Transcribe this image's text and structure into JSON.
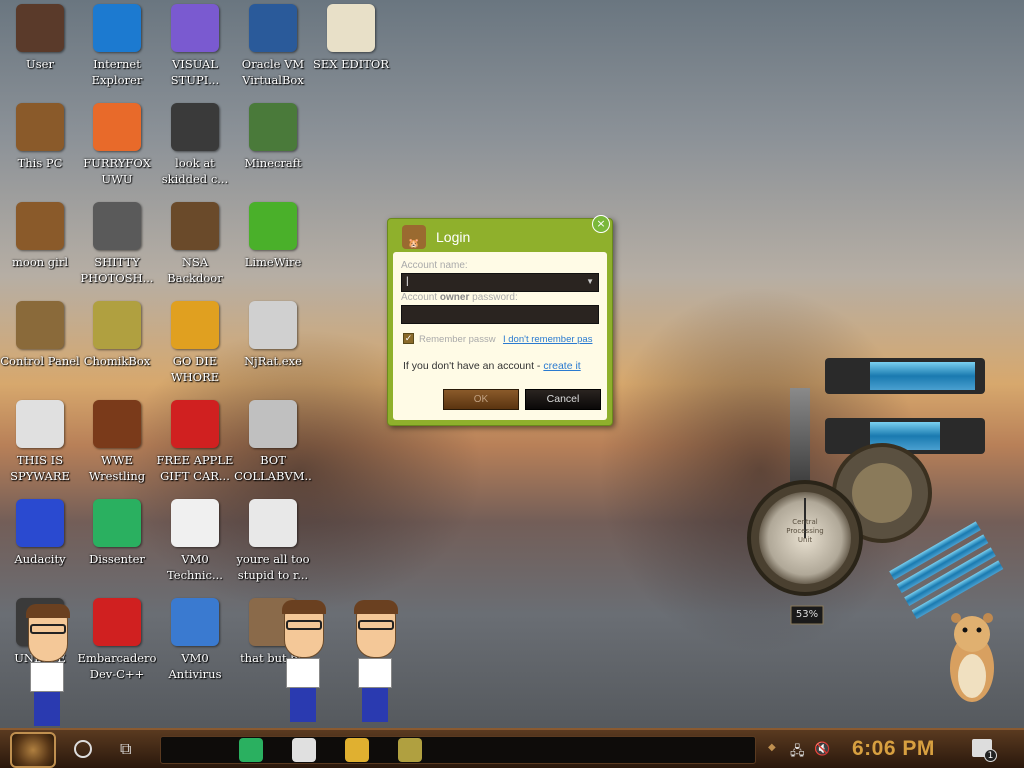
{
  "desktop": {
    "icons": [
      {
        "label": "User",
        "icon": "user-folder-icon",
        "color": "#5a3a2a"
      },
      {
        "label": "Internet Explorer",
        "icon": "edge-browser-icon",
        "color": "#1c7ad0"
      },
      {
        "label": "VISUAL STUPI...",
        "icon": "visual-studio-icon",
        "color": "#7a5ad0"
      },
      {
        "label": "Oracle VM VirtualBox",
        "icon": "virtualbox-icon",
        "color": "#2a5a9a"
      },
      {
        "label": "SEX EDITOR",
        "icon": "hxd-editor-icon",
        "color": "#e8e0c8"
      },
      {
        "label": "This PC",
        "icon": "computer-icon",
        "color": "#8a5a2a"
      },
      {
        "label": "FURRYFOX UWU",
        "icon": "firefox-icon",
        "color": "#e86a2a"
      },
      {
        "label": "look at skidded c...",
        "icon": "files-icon",
        "color": "#3a3a3a"
      },
      {
        "label": "Minecraft",
        "icon": "minecraft-icon",
        "color": "#4a7a3a"
      },
      {
        "label": "moon girl",
        "icon": "cabinet-icon",
        "color": "#8a5a2a"
      },
      {
        "label": "SHITTY PHOTOSH...",
        "icon": "gimp-icon",
        "color": "#5a5a5a"
      },
      {
        "label": "NSA Backdoor",
        "icon": "gear-box-icon",
        "color": "#6a4a2a"
      },
      {
        "label": "LimeWire",
        "icon": "limewire-icon",
        "color": "#4ab02a"
      },
      {
        "label": "Control Panel",
        "icon": "lightbulb-icon",
        "color": "#8a6a3a"
      },
      {
        "label": "ChomikBox",
        "icon": "chomikbox-icon",
        "color": "#b0a040"
      },
      {
        "label": "GO DIE WHORE",
        "icon": "die-icon",
        "color": "#e0a020"
      },
      {
        "label": "NjRat.exe",
        "icon": "skull-icon",
        "color": "#d0d0d0"
      },
      {
        "label": "THIS IS SPYWARE",
        "icon": "chrome-icon",
        "color": "#e0e0e0"
      },
      {
        "label": "WWE Wrestling",
        "icon": "oven-icon",
        "color": "#7a3a1a"
      },
      {
        "label": "FREE APPLE GIFT CAR...",
        "icon": "apple-icon",
        "color": "#d02020"
      },
      {
        "label": "BOT COLLABVM...",
        "icon": "monitor-icon",
        "color": "#c0c0c0"
      },
      {
        "label": "Audacity",
        "icon": "audacity-icon",
        "color": "#2a4ad0"
      },
      {
        "label": "Dissenter",
        "icon": "dissenter-icon",
        "color": "#2ab060"
      },
      {
        "label": "VM0 Technic...",
        "icon": "technician-icon",
        "color": "#f0f0f0"
      },
      {
        "label": "youre all too stupid to r...",
        "icon": "portrait-icon",
        "color": "#e8e8e8"
      },
      {
        "label": "UND... E",
        "icon": "undertale-icon",
        "color": "#3a3a3a"
      },
      {
        "label": "Embarcadero Dev-C++",
        "icon": "devcpp-icon",
        "color": "#d02020"
      },
      {
        "label": "VM0 Antivirus",
        "icon": "shield-icon",
        "color": "#3a7ad0"
      },
      {
        "label": "that but bit",
        "icon": "painting-icon",
        "color": "#8a6a4a"
      }
    ]
  },
  "login": {
    "title": "Login",
    "close_label": "×",
    "account_name_label": "Account name:",
    "account_name_value": "|",
    "password_label_prefix": "Account ",
    "password_label_bold": "owner",
    "password_label_suffix": " password:",
    "remember_label": "Remember passw",
    "forgot_label": "I don't remember pas",
    "no_account_text": "If you don't have an account - ",
    "create_label": "create it",
    "ok_label": "OK",
    "cancel_label": "Cancel"
  },
  "gadget": {
    "percent": "53%",
    "gauge_label": "Central Processing Unit"
  },
  "taskbar": {
    "clock": "6:06 PM",
    "notifications": "1",
    "apps": [
      {
        "name": "dissenter",
        "icon": "dissenter-icon",
        "color": "#2ab060"
      },
      {
        "name": "chrome",
        "icon": "chrome-icon",
        "color": "#e0e0e0"
      },
      {
        "name": "file-explorer",
        "icon": "folder-icon",
        "color": "#e0b030"
      },
      {
        "name": "chomikbox",
        "icon": "chomikbox-icon",
        "color": "#b0a040"
      }
    ]
  }
}
